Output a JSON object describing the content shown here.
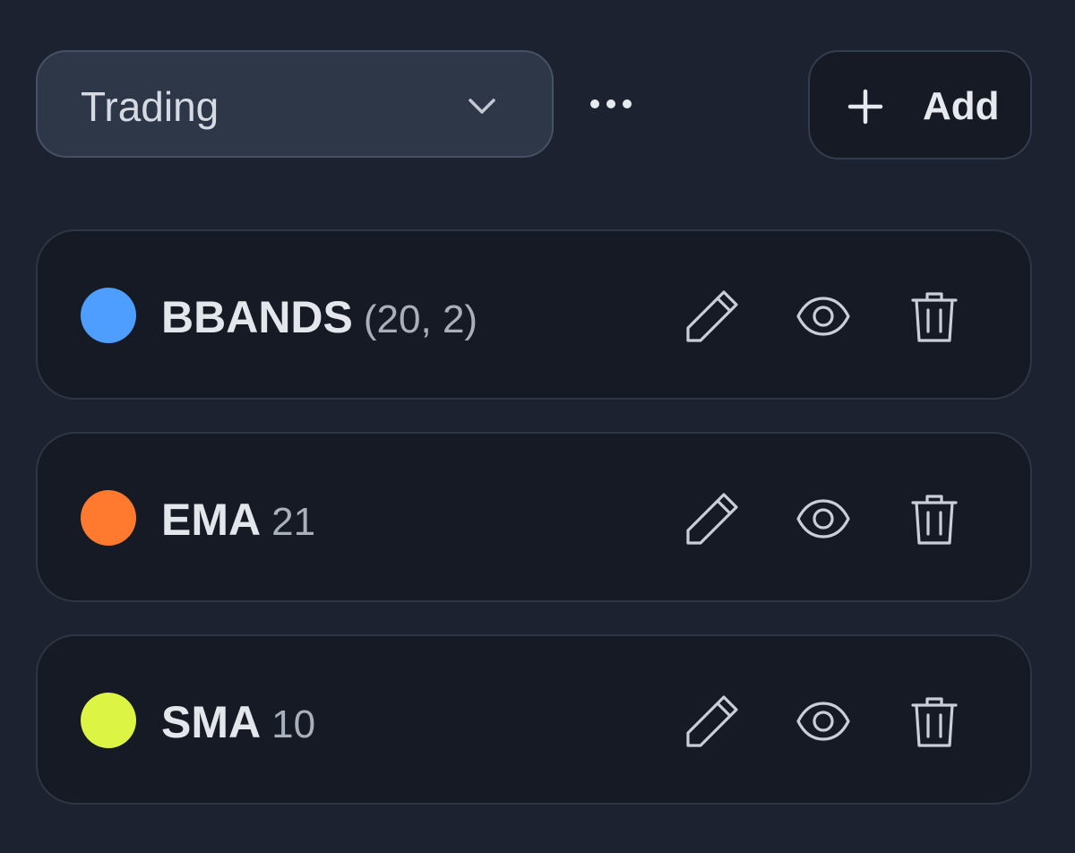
{
  "toolbar": {
    "preset_value": "Trading",
    "add_label": "Add"
  },
  "indicators": [
    {
      "name": "BBANDS",
      "params": "(20, 2)",
      "color": "#4d9eff"
    },
    {
      "name": "EMA",
      "params": "21",
      "color": "#ff7a2f"
    },
    {
      "name": "SMA",
      "params": "10",
      "color": "#dcf545"
    }
  ],
  "icons": {
    "preset_dropdown": "chevron-down-icon",
    "more": "more-horizontal-icon",
    "add": "plus-icon",
    "row_edit": "pencil-icon",
    "row_visibility": "eye-icon",
    "row_delete": "trash-icon"
  }
}
